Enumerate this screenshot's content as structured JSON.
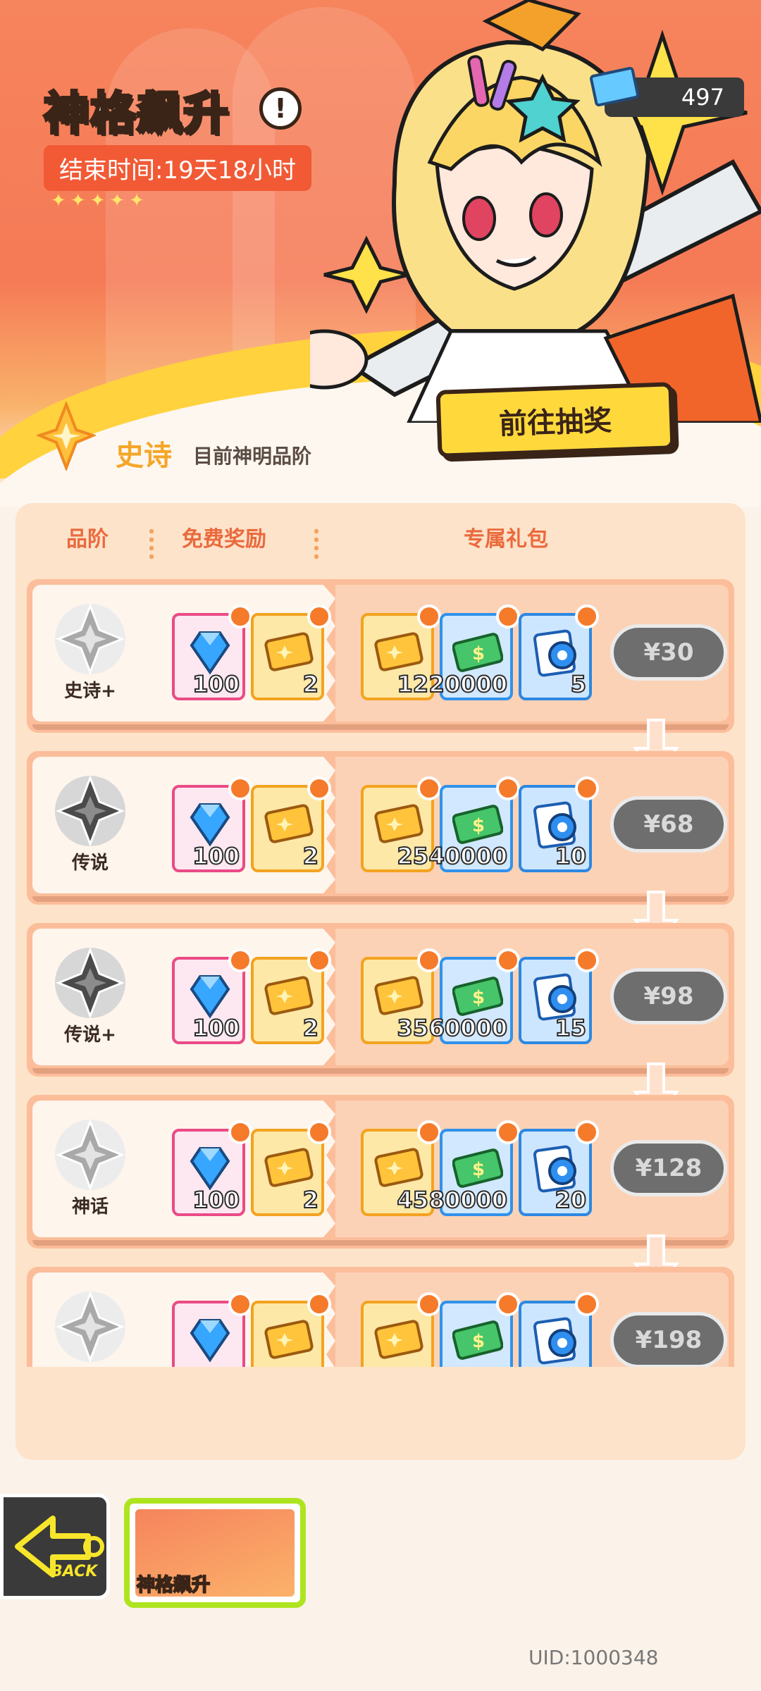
{
  "header": {
    "title": "神格飙升",
    "timer": "结束时间:19天18小时",
    "stars": "✦✦✦✦✦",
    "currency": "497",
    "draw_button": "前往抽奖",
    "info_glyph": "!"
  },
  "current_rank": {
    "name": "史诗",
    "desc": "目前神明品阶"
  },
  "table_headers": {
    "tier": "品阶",
    "free": "免费奖励",
    "exclusive": "专属礼包"
  },
  "rows": [
    {
      "tier": "史诗+",
      "free": [
        "100",
        "2"
      ],
      "pack": [
        "12",
        "20000",
        "5"
      ],
      "price": "¥30"
    },
    {
      "tier": "传说",
      "free": [
        "100",
        "2"
      ],
      "pack": [
        "25",
        "40000",
        "10"
      ],
      "price": "¥68"
    },
    {
      "tier": "传说+",
      "free": [
        "100",
        "2"
      ],
      "pack": [
        "35",
        "60000",
        "15"
      ],
      "price": "¥98"
    },
    {
      "tier": "神话",
      "free": [
        "100",
        "2"
      ],
      "pack": [
        "45",
        "80000",
        "20"
      ],
      "price": "¥128"
    },
    {
      "tier": "",
      "free": [
        "",
        ""
      ],
      "pack": [
        "",
        "",
        ""
      ],
      "price": "¥198"
    }
  ],
  "bottom": {
    "back": "BACK",
    "tab": "神格飙升",
    "uid": "UID:1000348"
  },
  "colors": {
    "accent": "#f57a56",
    "gold": "#ffd93c",
    "panel": "#fde3ca"
  }
}
